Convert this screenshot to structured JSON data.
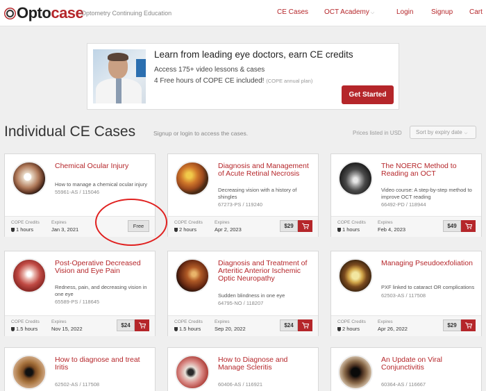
{
  "header": {
    "logo_part1": "Opto",
    "logo_part2": "case",
    "tagline": "Optometry Continuing Education",
    "nav": {
      "ce_cases": "CE Cases",
      "oct_academy": "OCT Academy",
      "login": "Login",
      "signup": "Signup",
      "cart": "Cart"
    }
  },
  "promo": {
    "title": "Learn from leading eye doctors, earn CE credits",
    "line1": "Access 175+ video lessons & cases",
    "line2": "4 Free hours of COPE CE included!",
    "line2_note": "(COPE annual plan)",
    "button": "Get Started"
  },
  "listing": {
    "title": "Individual CE Cases",
    "signup_note": "Signup or login to access the cases.",
    "prices_note": "Prices listed in USD",
    "sort_label": "Sort by expiry date"
  },
  "footer_labels": {
    "credits": "COPE Credits",
    "expires": "Expires"
  },
  "colors": {
    "accent": "#b5262a",
    "annotation": "#e0201f",
    "background": "#efefef"
  },
  "cards": [
    {
      "title": "Chemical Ocular Injury",
      "desc": "How to manage a chemical ocular injury",
      "code": "55961-AS / 115046",
      "credits": "1 hours",
      "expires": "Jan 3, 2021",
      "price": "Free",
      "thumb": "eye-injury"
    },
    {
      "title": "Diagnosis and Management of Acute Retinal Necrosis",
      "desc": "Decreasing vision with a history of shingles",
      "code": "67273-PS / 119240",
      "credits": "2 hours",
      "expires": "Apr 2, 2023",
      "price": "$29",
      "thumb": "retina-orange"
    },
    {
      "title": "The NOERC Method to Reading an OCT",
      "desc": "Video course: A step-by-step method to improve OCT reading",
      "code": "66492-PD / 118944",
      "credits": "1 hours",
      "expires": "Feb 4, 2023",
      "price": "$49",
      "thumb": "oct-scan"
    },
    {
      "title": "Post-Operative Decreased Vision and Eye Pain",
      "desc": "Redness, pain, and decreasing vision in one eye",
      "code": "65589-PS / 118645",
      "credits": "1.5 hours",
      "expires": "Nov 15, 2022",
      "price": "$24",
      "thumb": "red-eye"
    },
    {
      "title": "Diagnosis and Treatment of Arteritic Anterior Ischemic Optic Neuropathy",
      "desc": "Sudden blindness in one eye",
      "code": "64795-NO / 118207",
      "credits": "1.5 hours",
      "expires": "Sep 20, 2022",
      "price": "$24",
      "thumb": "fundus-dark"
    },
    {
      "title": "Managing Pseudoexfoliation",
      "desc": "PXF linked to cataract OR complications",
      "code": "62503-AS / 117508",
      "credits": "2 hours",
      "expires": "Apr 26, 2022",
      "price": "$29",
      "thumb": "lens-slitlamp"
    },
    {
      "title": "How to diagnose and treat Iritis",
      "code": "62502-AS / 117508",
      "thumb": "brown-iris"
    },
    {
      "title": "How to Diagnose and Manage Scleritis",
      "code": "60406-AS / 116921",
      "thumb": "scleritis-eye"
    },
    {
      "title": "An Update on Viral Conjunctivitis",
      "code": "60364-AS / 116667",
      "thumb": "dark-iris"
    }
  ]
}
